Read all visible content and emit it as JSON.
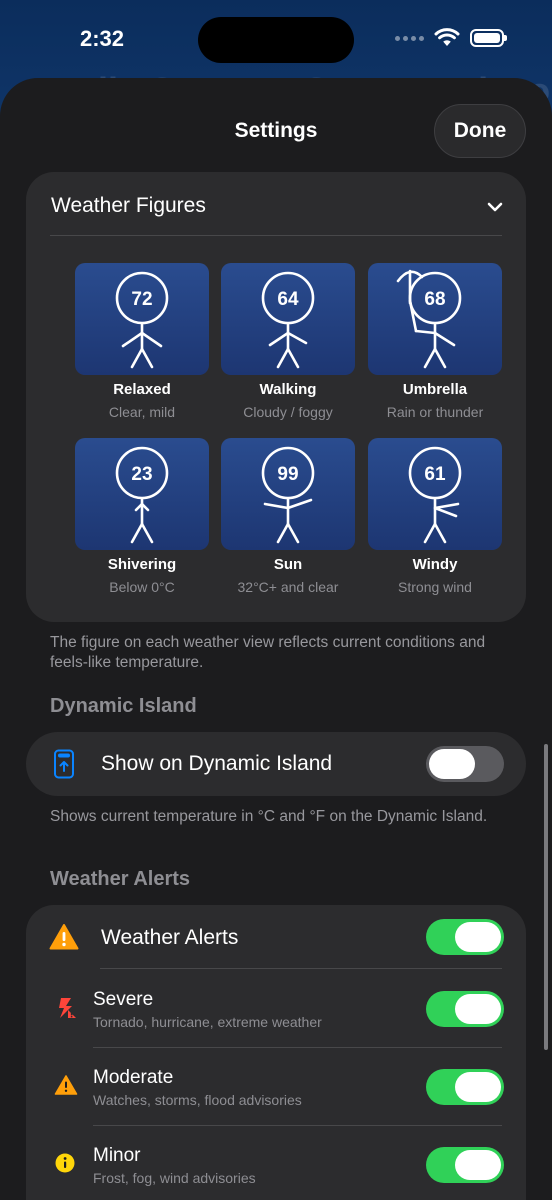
{
  "status_bar": {
    "time": "2:32"
  },
  "background_title": "Hello Summer San Francisco",
  "sheet": {
    "title": "Settings",
    "done_label": "Done"
  },
  "weather_figures": {
    "header": "Weather Figures",
    "figures": [
      {
        "temp": "72",
        "name": "Relaxed",
        "desc": "Clear, mild",
        "pose": "relaxed"
      },
      {
        "temp": "64",
        "name": "Walking",
        "desc": "Cloudy / foggy",
        "pose": "walking"
      },
      {
        "temp": "68",
        "name": "Umbrella",
        "desc": "Rain or thunder",
        "pose": "umbrella"
      },
      {
        "temp": "23",
        "name": "Shivering",
        "desc": "Below 0°C",
        "pose": "shivering"
      },
      {
        "temp": "99",
        "name": "Sun",
        "desc": "32°C+ and clear",
        "pose": "sun"
      },
      {
        "temp": "61",
        "name": "Windy",
        "desc": "Strong wind",
        "pose": "windy"
      }
    ],
    "footnote": "The figure on each weather view reflects current conditions and feels-like temperature."
  },
  "dynamic_island": {
    "section_title": "Dynamic Island",
    "label": "Show on Dynamic Island",
    "enabled": false,
    "footnote": "Shows current temperature in °C and °F on the Dynamic Island."
  },
  "weather_alerts": {
    "section_title": "Weather Alerts",
    "master": {
      "label": "Weather Alerts",
      "enabled": true
    },
    "items": [
      {
        "title": "Severe",
        "subtitle": "Tornado, hurricane, extreme weather",
        "enabled": true,
        "icon": "severe-bolt-icon"
      },
      {
        "title": "Moderate",
        "subtitle": "Watches, storms, flood advisories",
        "enabled": true,
        "icon": "warning-triangle-icon"
      },
      {
        "title": "Minor",
        "subtitle": "Frost, fog, wind advisories",
        "enabled": true,
        "icon": "info-circle-icon"
      }
    ]
  },
  "colors": {
    "accent_green": "#30d158",
    "warning_orange": "#ff9f0a",
    "severe_red": "#ff453a",
    "minor_yellow": "#ffd60a",
    "tile_blue": "#24427f"
  }
}
